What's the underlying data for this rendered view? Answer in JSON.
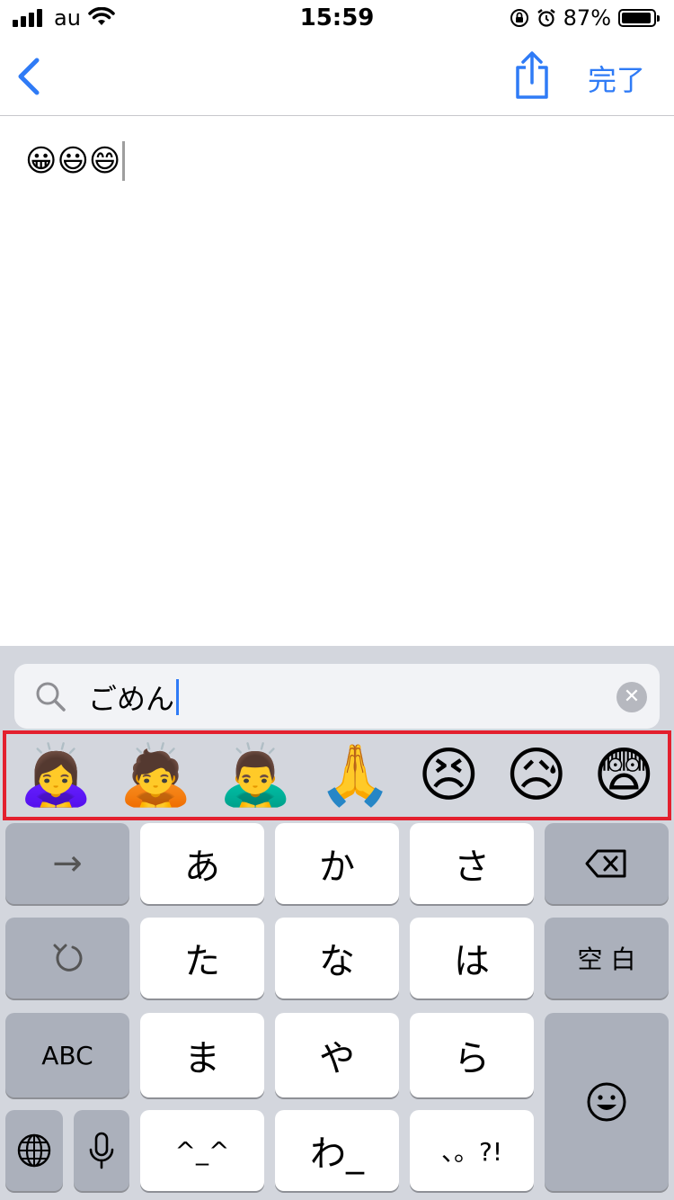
{
  "status_bar": {
    "carrier": "au",
    "time": "15:59",
    "battery_percent": "87%",
    "battery_level": 0.87,
    "icons": [
      "signal-icon",
      "wifi-icon",
      "orientation-lock-icon",
      "alarm-icon",
      "battery-icon"
    ]
  },
  "nav": {
    "back_icon": "chevron-left-icon",
    "share_icon": "share-icon",
    "done_label": "完了",
    "accent_color": "#2f7bf6"
  },
  "note": {
    "content": "😀😃😄"
  },
  "keyboard": {
    "search": {
      "value": "ごめん",
      "icon": "search-icon",
      "clear_icon": "clear-icon"
    },
    "emoji_suggestions": [
      "🙇‍♀️",
      "🙇",
      "🙇‍♂️",
      "🙏",
      "😣",
      "😥",
      "😨"
    ],
    "highlight_color": "#e3202e",
    "keys": {
      "next": "→",
      "a": "あ",
      "ka": "か",
      "sa": "さ",
      "delete_icon": "delete-icon",
      "undo_icon": "undo-icon",
      "ta": "た",
      "na": "な",
      "ha": "は",
      "space": "空 白",
      "abc": "ABC",
      "ma": "ま",
      "ya": "や",
      "ra": "ら",
      "emoji_icon": "emoji-icon",
      "globe_icon": "globe-icon",
      "mic_icon": "mic-icon",
      "kaomoji": "^_^",
      "wa": "わ_",
      "punct": "、。?!"
    }
  }
}
